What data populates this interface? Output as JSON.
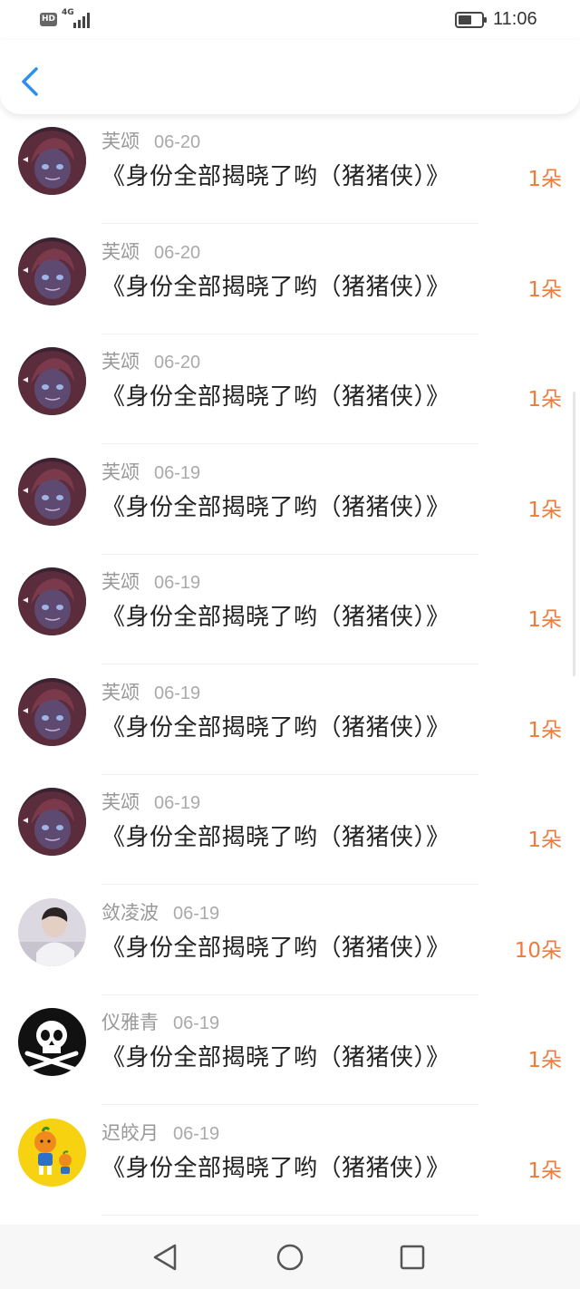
{
  "status_bar": {
    "hd_label": "HD",
    "network_label": "4G",
    "time": "11:06",
    "icons": [
      "signal-icon",
      "battery-icon"
    ]
  },
  "nav": {
    "back_icon": "chevron-left-icon",
    "accent_color": "#2e8ff0"
  },
  "colors": {
    "name": "#999999",
    "title": "#222222",
    "count": "#ef7a3a"
  },
  "list": [
    {
      "name": "芙颂",
      "date": "06-20",
      "title": "《身份全部揭晓了哟（猪猪侠）》",
      "count": "1朵",
      "avatar": "anime-girl"
    },
    {
      "name": "芙颂",
      "date": "06-20",
      "title": "《身份全部揭晓了哟（猪猪侠）》",
      "count": "1朵",
      "avatar": "anime-girl"
    },
    {
      "name": "芙颂",
      "date": "06-20",
      "title": "《身份全部揭晓了哟（猪猪侠）》",
      "count": "1朵",
      "avatar": "anime-girl"
    },
    {
      "name": "芙颂",
      "date": "06-19",
      "title": "《身份全部揭晓了哟（猪猪侠）》",
      "count": "1朵",
      "avatar": "anime-girl"
    },
    {
      "name": "芙颂",
      "date": "06-19",
      "title": "《身份全部揭晓了哟（猪猪侠）》",
      "count": "1朵",
      "avatar": "anime-girl"
    },
    {
      "name": "芙颂",
      "date": "06-19",
      "title": "《身份全部揭晓了哟（猪猪侠）》",
      "count": "1朵",
      "avatar": "anime-girl"
    },
    {
      "name": "芙颂",
      "date": "06-19",
      "title": "《身份全部揭晓了哟（猪猪侠）》",
      "count": "1朵",
      "avatar": "anime-girl"
    },
    {
      "name": "敛凌波",
      "date": "06-19",
      "title": "《身份全部揭晓了哟（猪猪侠）》",
      "count": "10朵",
      "avatar": "photo-person"
    },
    {
      "name": "仪雅青",
      "date": "06-19",
      "title": "《身份全部揭晓了哟（猪猪侠）》",
      "count": "1朵",
      "avatar": "skull"
    },
    {
      "name": "迟皎月",
      "date": "06-19",
      "title": "《身份全部揭晓了哟（猪猪侠）》",
      "count": "1朵",
      "avatar": "orange-cartoon"
    }
  ],
  "system_nav": {
    "buttons": [
      "back-triangle-icon",
      "home-circle-icon",
      "recents-square-icon"
    ]
  }
}
